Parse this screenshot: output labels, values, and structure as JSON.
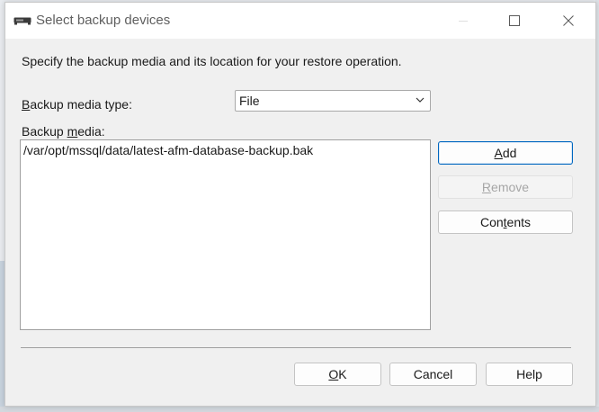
{
  "window": {
    "title": "Select backup devices",
    "icon": "tape-drive-icon"
  },
  "intro_text": "Specify the backup media and its location for your restore operation.",
  "media_type": {
    "label_prefix": "",
    "label_mnemonic": "B",
    "label_rest": "ackup media type:",
    "selected": "File"
  },
  "media": {
    "label_prefix": "Backup ",
    "label_mnemonic": "m",
    "label_rest": "edia:",
    "items": [
      "/var/opt/mssql/data/latest-afm-database-backup.bak"
    ]
  },
  "buttons": {
    "add": {
      "prefix": "",
      "mnemonic": "A",
      "rest": "dd"
    },
    "remove": {
      "prefix": "",
      "mnemonic": "R",
      "rest": "emove"
    },
    "contents": {
      "prefix": "Con",
      "mnemonic": "t",
      "rest": "ents"
    },
    "ok": {
      "prefix": "",
      "mnemonic": "O",
      "rest": "K"
    },
    "cancel": "Cancel",
    "help": "Help"
  },
  "colors": {
    "accent": "#0067c0",
    "disabled_text": "#a6a6a6"
  }
}
